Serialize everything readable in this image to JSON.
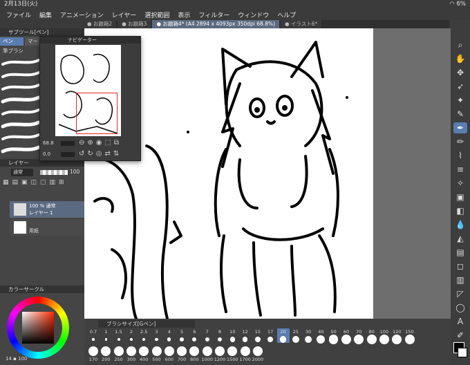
{
  "status": {
    "datetime": "2月13日(火)",
    "battery": "6%"
  },
  "menu": [
    "ファイル",
    "編集",
    "アニメーション",
    "レイヤー",
    "選択範囲",
    "表示",
    "フィルター",
    "ウィンドウ",
    "ヘルプ"
  ],
  "tabs": [
    "お題箱2",
    "お題箱3",
    "お題箱4* (A4 2894 x 4093px 350dpi 68.8%)",
    "イラスト6*"
  ],
  "subtool": {
    "title": "サブツール[ペン]",
    "tab_pen": "ペン",
    "tab_marker": "マー",
    "group": "筆ブラシ"
  },
  "navigator": {
    "title": "ナビゲーター",
    "zoom": "68.8",
    "angle": "0.0"
  },
  "layer": {
    "title": "レイヤー",
    "blend": "通常",
    "opacity": "100",
    "layer1_info": "100 % 通常",
    "layer1_name": "レイヤー 1",
    "paper_name": "用紙"
  },
  "color": {
    "title": "カラーサークル",
    "hue_hex": "#ff2a00"
  },
  "footer": {
    "v1": "14",
    "v2": "100"
  },
  "brush": {
    "title": "ブラシサイズ[Gペン]",
    "row1": [
      "0.7",
      "1",
      "1.5",
      "2",
      "2.5",
      "3",
      "4",
      "5",
      "6",
      "7",
      "8",
      "10",
      "12",
      "15",
      "17",
      "20",
      "25",
      "30",
      "40",
      "50",
      "60",
      "70",
      "80",
      "100",
      "120",
      "150"
    ],
    "row2": [
      "170",
      "200",
      "250",
      "300",
      "400",
      "500",
      "600",
      "700",
      "800",
      "1000",
      "1200",
      "1500",
      "1700",
      "2000"
    ],
    "selected": "20"
  }
}
